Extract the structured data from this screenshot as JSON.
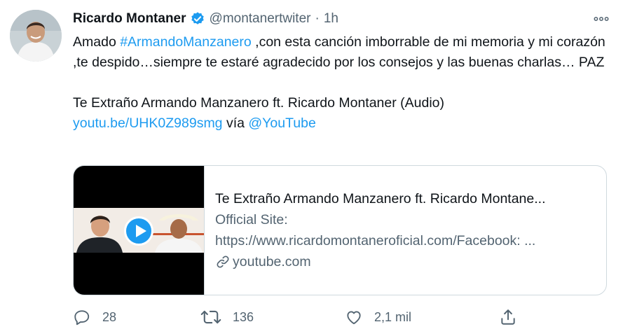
{
  "tweet": {
    "author": {
      "name": "Ricardo Montaner",
      "handle": "@montanertwiter",
      "verified": true,
      "avatar": "avatar-photo"
    },
    "separator": "·",
    "time": "1h",
    "text": {
      "part1": "Amado ",
      "hashtag": "#ArmandoManzanero",
      "part2": " ,con esta canción imborrable de mi memoria y mi corazón ,te despido…siempre te estaré agradecido por los consejos y las buenas charlas… PAZ",
      "video_title": "Te Extraño Armando Manzanero ft. Ricardo Montaner (Audio)",
      "link": "youtu.be/UHK0Z989smg",
      "via": " vía ",
      "mention": "@YouTube"
    },
    "card": {
      "title": "Te Extraño Armando Manzanero ft. Ricardo Montane...",
      "description_line1": "Official Site:",
      "description_line2": "https://www.ricardomontaneroficial.com/Facebook: ...",
      "domain": "youtube.com"
    },
    "actions": {
      "replies": "28",
      "retweets": "136",
      "likes": "2,1 mil"
    }
  },
  "icons": {
    "verified": "verified-badge-icon",
    "more": "more-icon",
    "play": "play-icon",
    "link": "link-icon",
    "reply": "reply-icon",
    "retweet": "retweet-icon",
    "like": "like-icon",
    "share": "share-icon"
  },
  "colors": {
    "accent": "#1d9bf0",
    "text": "#0f1419",
    "secondary": "#536471",
    "border": "#cfd9de"
  }
}
